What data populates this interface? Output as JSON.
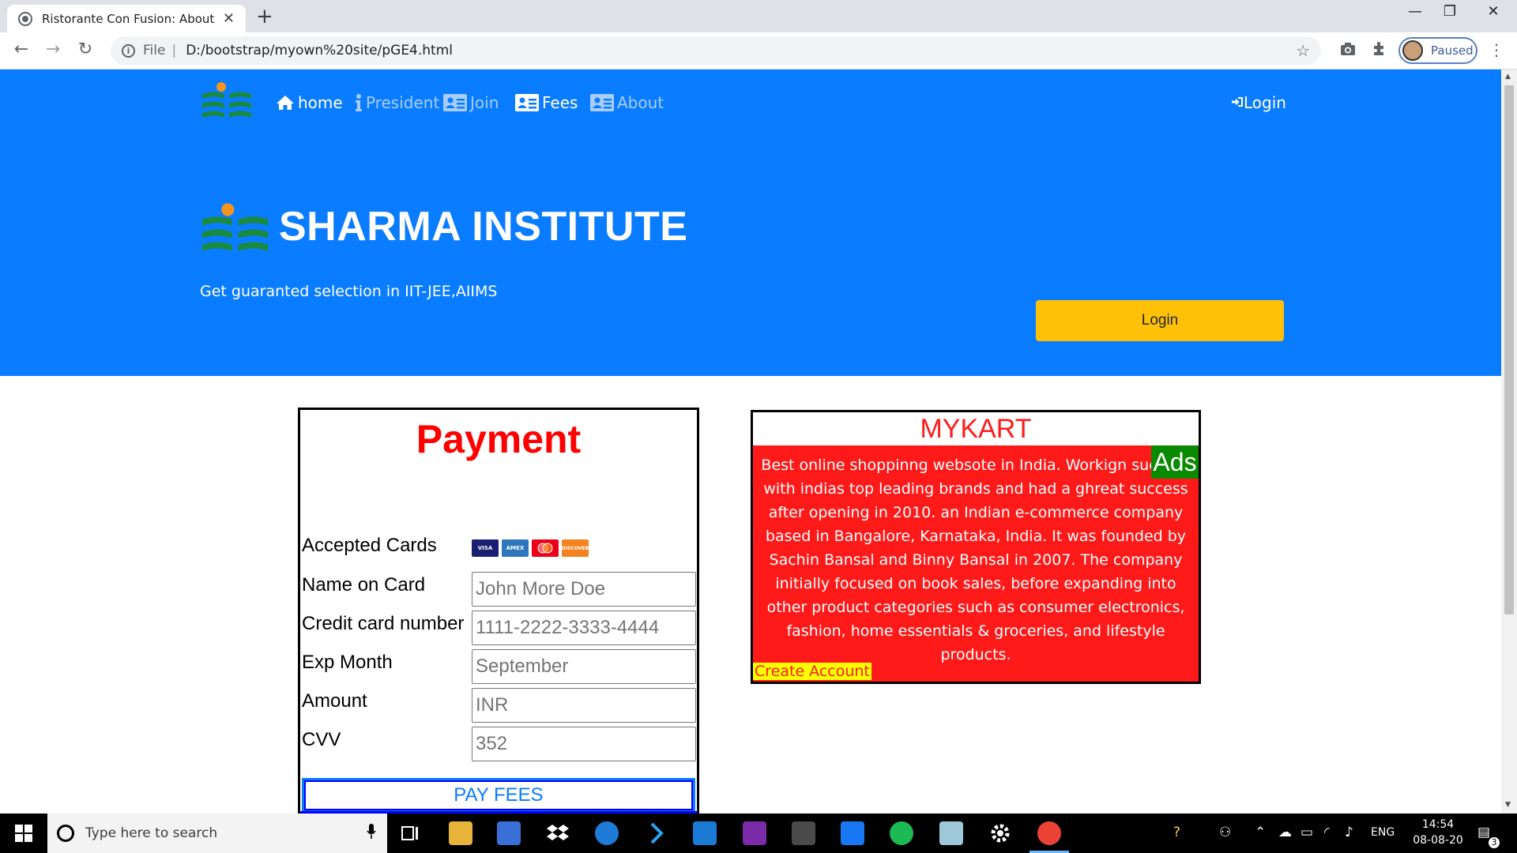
{
  "browser": {
    "tab_title": "Ristorante Con Fusion: About Us",
    "new_tab": "+",
    "close_tab": "✕",
    "minimize": "—",
    "maximize": "❐",
    "close_window": "✕",
    "back": "←",
    "forward": "→",
    "reload": "↻",
    "info": "i",
    "scheme": "File",
    "separator": "|",
    "url": "D:/bootstrap/myown%20site/pGE4.html",
    "profile_label": "Paused",
    "menu": "⋮"
  },
  "nav": {
    "items": [
      {
        "label": "home",
        "icon": "home-icon",
        "active": true
      },
      {
        "label": "President",
        "icon": "info-icon",
        "active": false
      },
      {
        "label": "Join",
        "icon": "address-card-icon",
        "active": false
      },
      {
        "label": "Fees",
        "icon": "address-card-icon",
        "active": true
      },
      {
        "label": "About",
        "icon": "address-card-icon",
        "active": false
      }
    ],
    "login": "Login"
  },
  "jumbotron": {
    "title": "SHARMA INSTITUTE",
    "subtitle": "Get guaranted selection in IIT-JEE,AIIMS",
    "login_button": "Login"
  },
  "payment": {
    "title": "Payment",
    "accepted_cards_label": "Accepted Cards",
    "cards": [
      "VISA",
      "AMEX",
      "MC",
      "DISCOVER"
    ],
    "fields": [
      {
        "label": "Name on Card",
        "placeholder": "John More Doe"
      },
      {
        "label": "Credit card number",
        "placeholder": "1111-2222-3333-4444"
      },
      {
        "label": "Exp Month",
        "placeholder": "September"
      },
      {
        "label": "Amount",
        "placeholder": "INR"
      },
      {
        "label": "CVV",
        "placeholder": "352"
      }
    ],
    "submit": "PAY FEES"
  },
  "mykart": {
    "title": "MYKART",
    "badge": "Ads",
    "description": "Best online shoppinng websote in India. Workign success with indias top leading brands and had a ghreat success after opening in 2010. an Indian e-commerce company based in Bangalore, Karnataka, India. It was founded by Sachin Bansal and Binny Bansal in 2007. The company initially focused on book sales, before expanding into other product categories such as consumer electronics, fashion, home essentials & groceries, and lifestyle products.",
    "link": "Create Account"
  },
  "taskbar": {
    "search_placeholder": "Type here to search",
    "language": "ENG",
    "time": "14:54",
    "date": "08-08-20",
    "notification_count": "3"
  },
  "colors": {
    "primary": "#0a7cff",
    "warning": "#ffc107",
    "danger": "#ff1a1a",
    "ads_green": "#0a8a00"
  }
}
